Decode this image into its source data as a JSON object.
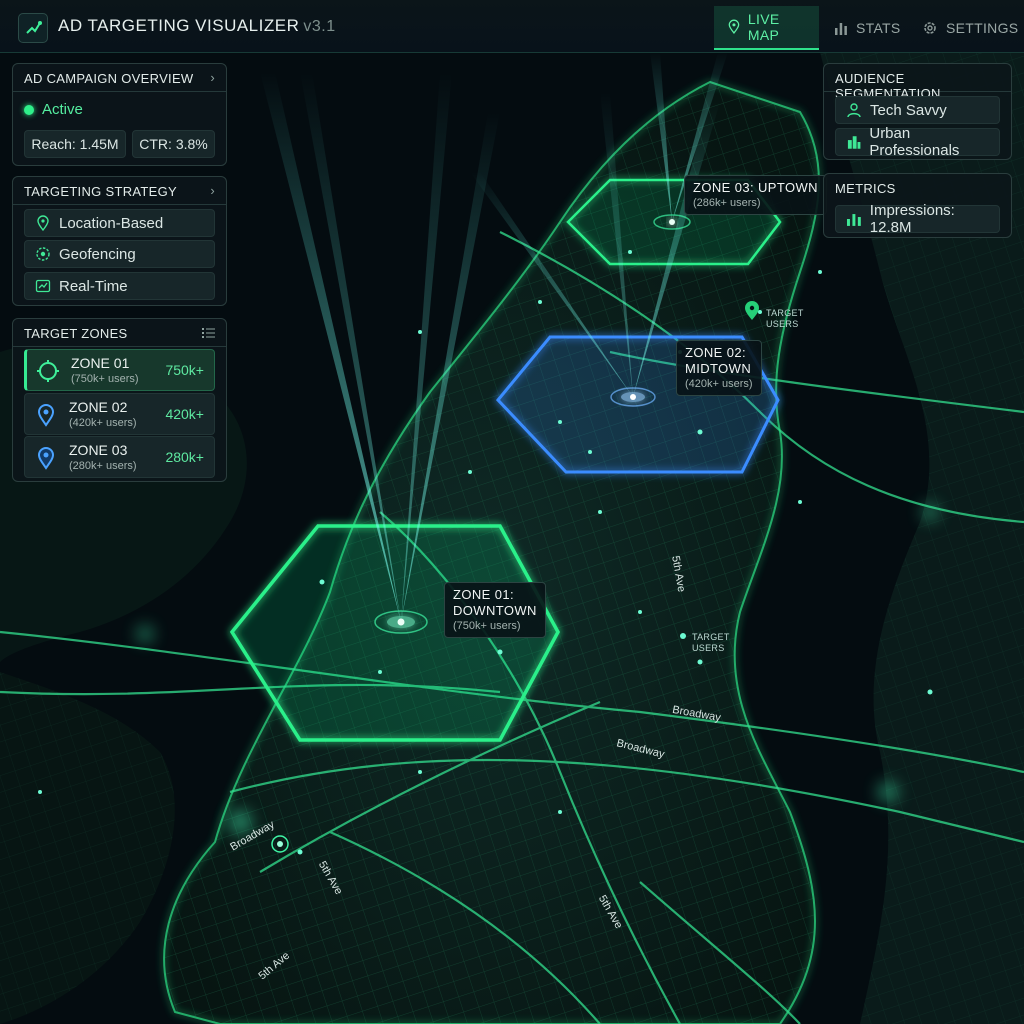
{
  "header": {
    "title": "AD TARGETING VISUALIZER",
    "version": "v3.1",
    "tabs": [
      {
        "label": "LIVE MAP",
        "icon": "map-pin-icon",
        "active": true
      },
      {
        "label": "STATS",
        "icon": "bar-chart-icon",
        "active": false
      },
      {
        "label": "SETTINGS",
        "icon": "gear-icon",
        "active": false
      }
    ]
  },
  "campaign": {
    "title": "AD CAMPAIGN OVERVIEW",
    "status": "Active",
    "reach": "Reach: 1.45M",
    "ctr": "CTR: 3.8%"
  },
  "strategy": {
    "title": "TARGETING STRATEGY",
    "items": [
      {
        "label": "Location-Based",
        "icon": "location-pin-icon"
      },
      {
        "label": "Geofencing",
        "icon": "geofence-icon"
      },
      {
        "label": "Real-Time",
        "icon": "realtime-icon"
      }
    ]
  },
  "zones": {
    "title": "TARGET ZONES",
    "items": [
      {
        "name": "ZONE 01",
        "users": "(750k+ users)",
        "value": "750k+",
        "selected": true
      },
      {
        "name": "ZONE 02",
        "users": "(420k+ users)",
        "value": "420k+",
        "selected": false
      },
      {
        "name": "ZONE 03",
        "users": "(280k+ users)",
        "value": "280k+",
        "selected": false
      }
    ]
  },
  "audience": {
    "title": "AUDIENCE SEGMENTATION",
    "items": [
      {
        "label": "Tech Savvy",
        "icon": "user-icon"
      },
      {
        "label": "Urban Professionals",
        "icon": "building-icon"
      }
    ]
  },
  "metrics": {
    "title": "METRICS",
    "impressions": "Impressions: 12.8M"
  },
  "map": {
    "zone_labels": [
      {
        "title": "ZONE 03: UPTOWN",
        "sub": "(286k+ users)"
      },
      {
        "title": "ZONE 02:",
        "title2": "MIDTOWN",
        "sub": "(420k+ users)"
      },
      {
        "title": "ZONE 01:",
        "title2": "DOWNTOWN",
        "sub": "(750k+ users)"
      }
    ],
    "target_users": [
      "TARGET",
      "USERS"
    ],
    "streets": [
      "Broadway",
      "Broadway",
      "Broadway",
      "5th Ave",
      "5th Ave",
      "5th Ave",
      "5th Ave"
    ],
    "colors": {
      "zone_green": "#2bf08a",
      "zone_blue": "#3a8cff",
      "beam": "#5ff7e8",
      "road": "#1f8a5a"
    }
  }
}
